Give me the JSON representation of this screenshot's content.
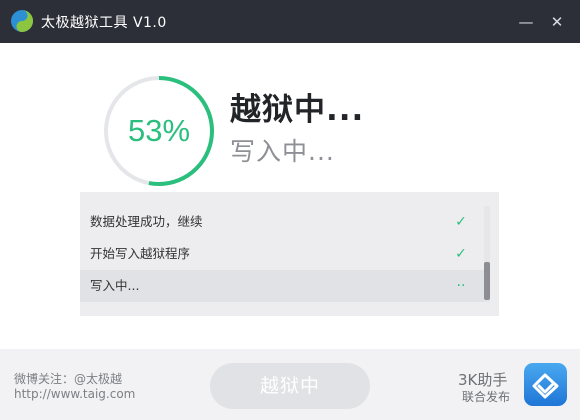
{
  "window": {
    "title": "太极越狱工具 V1.0",
    "minimize_glyph": "—",
    "close_glyph": "✕"
  },
  "progress": {
    "percent_label": "53%",
    "fraction": 0.53,
    "status": "越狱中...",
    "substatus": "写入中..."
  },
  "log": {
    "rows": [
      {
        "text": "数据处理成功，继续",
        "mark": "✓",
        "state": "done"
      },
      {
        "text": "开始写入越狱程序",
        "mark": "✓",
        "state": "done"
      },
      {
        "text": "写入中...",
        "mark": "··",
        "state": "in-progress"
      }
    ]
  },
  "footer": {
    "weibo": "微博关注：@太极越",
    "url": "http://www.taig.com",
    "action_button": "越狱中",
    "partner_name": "3K助手",
    "partner_sub": "联合发布"
  },
  "colors": {
    "accent_green": "#2bbf7e",
    "titlebar": "#2c2f38",
    "partner_blue": "#2f8ee8"
  },
  "icons": {
    "app_logo": "taiji-logo-icon",
    "partner_logo": "3k-assistant-logo-icon",
    "done_mark": "check-icon"
  }
}
